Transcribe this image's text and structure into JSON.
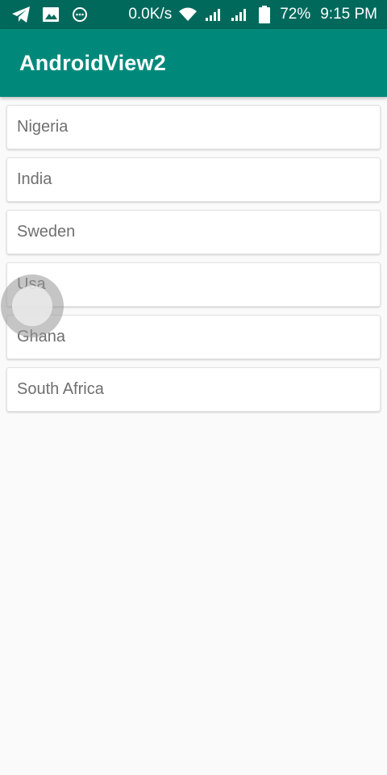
{
  "status_bar": {
    "left_icons": [
      "telegram-icon",
      "image-icon",
      "chat-bubble-icon"
    ],
    "network_speed": "0.0K/s",
    "right_icons": [
      "wifi-icon",
      "signal-icon-1",
      "signal-icon-2",
      "battery-icon"
    ],
    "battery": "72%",
    "time": "9:15 PM"
  },
  "app_bar": {
    "title": "AndroidView2"
  },
  "list": {
    "items": [
      {
        "label": "Nigeria"
      },
      {
        "label": "India"
      },
      {
        "label": "Sweden"
      },
      {
        "label": "Usa"
      },
      {
        "label": "Ghana"
      },
      {
        "label": "South Africa"
      }
    ]
  },
  "colors": {
    "status_bar_bg": "#00695c",
    "app_bar_bg": "#00897b",
    "page_bg": "#fafafa",
    "item_text": "#6f6f6f"
  }
}
